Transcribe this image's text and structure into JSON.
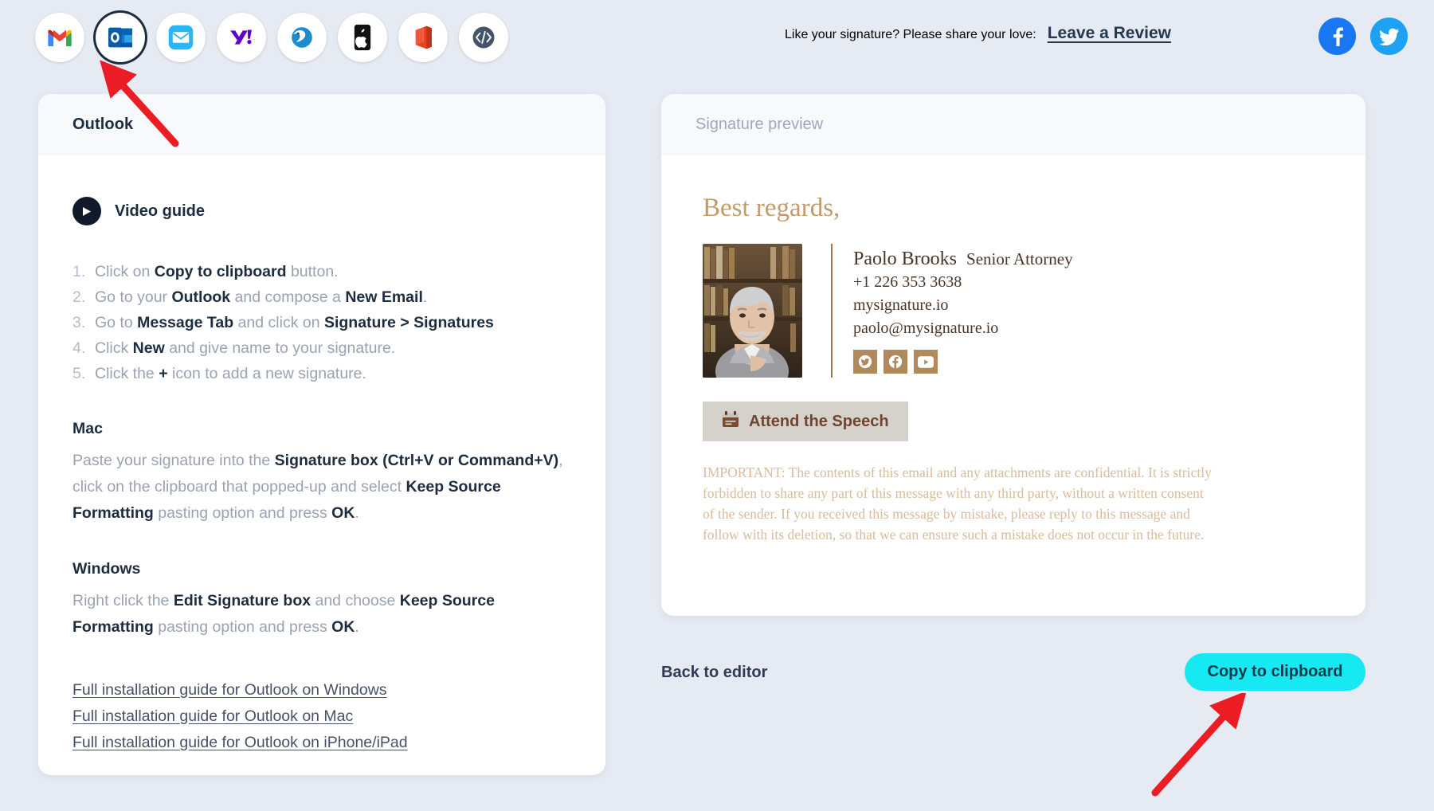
{
  "topbar": {
    "apps": [
      {
        "name": "gmail",
        "label": "Gmail",
        "selected": false
      },
      {
        "name": "outlook",
        "label": "Outlook",
        "selected": true
      },
      {
        "name": "apple-mail",
        "label": "Apple Mail",
        "selected": false
      },
      {
        "name": "yahoo-mail",
        "label": "Yahoo Mail",
        "selected": false
      },
      {
        "name": "thunderbird",
        "label": "Thunderbird",
        "selected": false
      },
      {
        "name": "iphone",
        "label": "iPhone",
        "selected": false
      },
      {
        "name": "office365",
        "label": "Office 365",
        "selected": false
      },
      {
        "name": "html-code",
        "label": "HTML code",
        "selected": false
      }
    ],
    "share_text": "Like your signature? Please share your love:",
    "review_link": "Leave a Review",
    "social": [
      {
        "name": "facebook-icon",
        "color": "#1877f2"
      },
      {
        "name": "twitter-icon",
        "color": "#1da1f2"
      }
    ]
  },
  "left_panel": {
    "title": "Outlook",
    "video_guide_label": "Video guide",
    "steps": [
      {
        "num": "1.",
        "html": "Click on <b>Copy to clipboard</b> button."
      },
      {
        "num": "2.",
        "html": "Go to your <b>Outlook</b> and compose a <b>New Email</b>."
      },
      {
        "num": "3.",
        "html": "Go to <b>Message Tab</b> and click on <b>Signature &gt; Signatures</b>"
      },
      {
        "num": "4.",
        "html": "Click <b>New</b> and give name to your signature."
      },
      {
        "num": "5.",
        "html": "Click the <b>+</b> icon to add a new signature."
      }
    ],
    "mac_heading": "Mac",
    "mac_text": "Paste your signature into the <b>Signature box (Ctrl+V or Command+V)</b>, click on the clipboard that popped-up and select <b>Keep Source Formatting</b> pasting option and press <b>OK</b>.",
    "windows_heading": "Windows",
    "windows_text": "Right click the <b>Edit Signature box</b> and choose <b>Keep Source Formatting</b> pasting option and press <b>OK</b>.",
    "guide_links": [
      "Full installation guide for Outlook on Windows",
      "Full installation guide for Outlook on Mac",
      "Full installation guide for Outlook on iPhone/iPad"
    ]
  },
  "right_panel": {
    "header_title": "Signature preview",
    "signature": {
      "regards": "Best regards,",
      "name": "Paolo Brooks",
      "job_title": "Senior Attorney",
      "phone": "+1 226 353 3638",
      "website": "mysignature.io",
      "email": "paolo@mysignature.io",
      "socials": [
        {
          "name": "twitter-icon"
        },
        {
          "name": "facebook-icon"
        },
        {
          "name": "youtube-icon"
        }
      ],
      "cta_label": "Attend the Speech",
      "disclaimer": "IMPORTANT: The contents of this email and any attachments are confidential. It is strictly forbidden to share any part of this message with any third party, without a written consent of the sender. If you received this message by mistake, please reply to this message and follow with its deletion, so that we can ensure such a mistake does not occur in the future.",
      "accent_color": "#b08a5e",
      "disclaimer_color": "#d8bc9b"
    },
    "back_label": "Back to editor",
    "copy_label": "Copy to clipboard",
    "copy_color": "#16e9f2"
  },
  "annotations": {
    "arrow_color": "#ec1c24",
    "arrow_to_outlook_icon": "points at Outlook app icon",
    "arrow_to_copy_button": "points at Copy to clipboard button"
  }
}
